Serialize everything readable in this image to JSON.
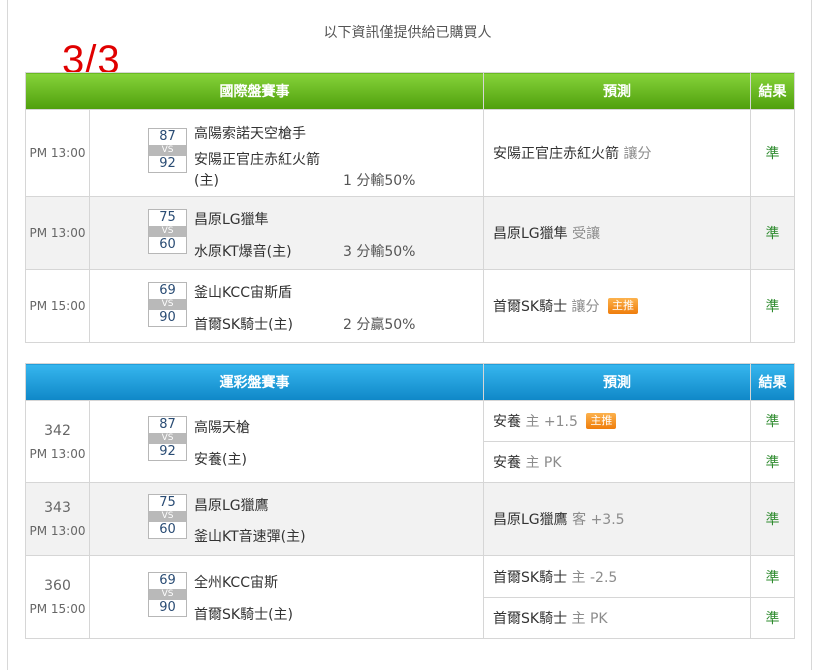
{
  "notice": "以下資訊僅提供給已購買人",
  "page_mark": "3/3",
  "intl": {
    "headers": [
      "國際盤賽事",
      "預測",
      "結果"
    ],
    "rows": [
      {
        "time": "PM 13:00",
        "score_home": "87",
        "score_away": "92",
        "vs": "VS",
        "team1": "高陽索諾天空槍手",
        "team2a": "安陽正官庄赤紅火箭",
        "team2b": "(主)",
        "handicap": "1 分輸50%",
        "prediction": "安陽正官庄赤紅火箭",
        "pred_type": "讓分",
        "badge": "",
        "result": "準"
      },
      {
        "time": "PM 13:00",
        "score_home": "75",
        "score_away": "60",
        "vs": "VS",
        "team1": "昌原LG獵隼",
        "team2": "水原KT爆音(主)",
        "handicap": "3 分輸50%",
        "prediction": "昌原LG獵隼",
        "pred_type": "受讓",
        "badge": "",
        "result": "準"
      },
      {
        "time": "PM 15:00",
        "score_home": "69",
        "score_away": "90",
        "vs": "VS",
        "team1": "釜山KCC宙斯盾",
        "team2": "首爾SK騎士(主)",
        "handicap": "2 分贏50%",
        "prediction": "首爾SK騎士",
        "pred_type": "讓分",
        "badge": "主推",
        "result": "準"
      }
    ]
  },
  "lottery": {
    "headers": [
      "運彩盤賽事",
      "預測",
      "結果"
    ],
    "rows": [
      {
        "code": "342",
        "time": "PM 13:00",
        "score_home": "87",
        "score_away": "92",
        "vs": "VS",
        "team1": "高陽天槍",
        "team2": "安養(主)",
        "preds": [
          {
            "team": "安養",
            "side": "主",
            "line": "+1.5",
            "badge": "主推",
            "result": "準"
          },
          {
            "team": "安養",
            "side": "主",
            "line": "PK",
            "badge": "",
            "result": "準"
          }
        ]
      },
      {
        "code": "343",
        "time": "PM 13:00",
        "score_home": "75",
        "score_away": "60",
        "vs": "VS",
        "team1": "昌原LG獵鷹",
        "team2": "釜山KT音速彈(主)",
        "preds": [
          {
            "team": "昌原LG獵鷹",
            "side": "客",
            "line": "+3.5",
            "badge": "",
            "result": "準"
          }
        ]
      },
      {
        "code": "360",
        "time": "PM 15:00",
        "score_home": "69",
        "score_away": "90",
        "vs": "VS",
        "team1": "全州KCC宙斯",
        "team2": "首爾SK騎士(主)",
        "preds": [
          {
            "team": "首爾SK騎士",
            "side": "主",
            "line": "-2.5",
            "badge": "",
            "result": "準"
          },
          {
            "team": "首爾SK騎士",
            "side": "主",
            "line": "PK",
            "badge": "",
            "result": "準"
          }
        ]
      }
    ]
  }
}
